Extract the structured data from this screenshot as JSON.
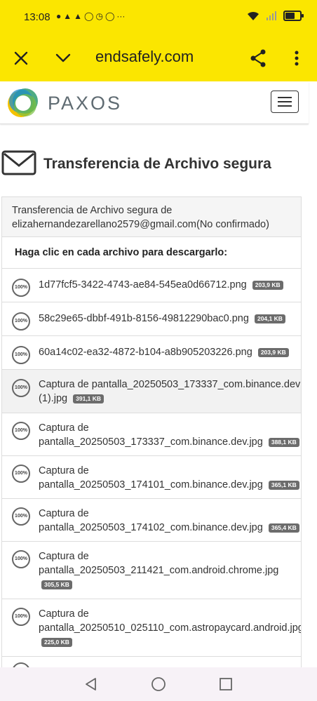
{
  "status_bar": {
    "time": "13:08",
    "notification_icons": [
      "chat-bubble-icon",
      "snapchat-icon",
      "snapchat-icon",
      "whatsapp-icon",
      "clock-icon",
      "facebook-icon"
    ],
    "more": "···",
    "battery_level": 0.7
  },
  "browser": {
    "url": "endsafely.com"
  },
  "site": {
    "logo_text": "PAXOS",
    "logo_colors": [
      "#f3c200",
      "#2f9e6f",
      "#1f8fd0",
      "#7ac143"
    ]
  },
  "page": {
    "title": "Transferencia de Archivo segura",
    "sender_line": "Transferencia de Archivo segura de elizahernandezarellano2579@gmail.com(No confirmado)",
    "instruction": "Haga clic en cada archivo para descargarlo:",
    "files": [
      {
        "progress": "100%",
        "name": "1d77fcf5-3422-4743-ae84-545ea0d66712.png",
        "size": "203,9 KB"
      },
      {
        "progress": "100%",
        "name": "58c29e65-dbbf-491b-8156-49812290bac0.png",
        "size": "204,1 KB"
      },
      {
        "progress": "100%",
        "name": "60a14c02-ea32-4872-b104-a8b905203226.png",
        "size": "203,9 KB"
      },
      {
        "progress": "100%",
        "name": "Captura de pantalla_20250503_173337_com.binance.dev (1).jpg",
        "size": "391,1 KB"
      },
      {
        "progress": "100%",
        "name": "Captura de pantalla_20250503_173337_com.binance.dev.jpg",
        "size": "388,1 KB"
      },
      {
        "progress": "100%",
        "name": "Captura de pantalla_20250503_174101_com.binance.dev.jpg",
        "size": "365,1 KB"
      },
      {
        "progress": "100%",
        "name": "Captura de pantalla_20250503_174102_com.binance.dev.jpg",
        "size": "365,4 KB"
      },
      {
        "progress": "100%",
        "name": "Captura de pantalla_20250503_211421_com.android.chrome.jpg",
        "size": "305,5 KB"
      },
      {
        "progress": "100%",
        "name": "Captura de pantalla_20250510_025110_com.astropaycard.android.jpg",
        "size": "225,0 KB"
      }
    ]
  }
}
